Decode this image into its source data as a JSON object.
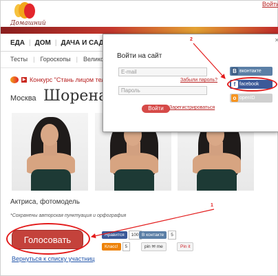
{
  "header": {
    "logo_text": "Домашний",
    "login_link": "Войти"
  },
  "nav": {
    "items": [
      "ЕДА",
      "ДОМ",
      "ДАЧА И САД"
    ]
  },
  "subnav": {
    "items": [
      "Тесты",
      "Гороскопы",
      "Великолеп"
    ]
  },
  "breadcrumb": {
    "link": "Конкурс \"Стань лицом теле"
  },
  "profile": {
    "city": "Москва",
    "name": "Шорена",
    "description": "Актриса, фотомодель",
    "note": "*Сохранены авторская пунктуация и орфография"
  },
  "actions": {
    "vote_label": "Голосовать",
    "back_link": "Вернуться к списку участниц"
  },
  "social": {
    "fb_label": "Нравится",
    "fb_count": "100",
    "vk_label": "В контакте",
    "vk_count": "5",
    "ok_label": "Класс!",
    "ok_count": "5",
    "pin_label": "pin ✉ me",
    "pinterest_label": "Pin it"
  },
  "modal": {
    "title": "Войти на сайт",
    "close": "✕",
    "email_placeholder": "E-mail",
    "password_placeholder": "Пароль",
    "forgot_link": "Забыли пароль?",
    "login_label": "Войти",
    "register_link": "Зарегистрироваться",
    "vk_button": "вконтакте",
    "fb_button": "facebook",
    "openid_button": "openID"
  },
  "annotations": {
    "marker1": "1",
    "marker2": "2"
  },
  "colors": {
    "brand_red": "#c4423b",
    "facebook": "#3b5998",
    "vk": "#5b7fa6",
    "annotation": "#e31b1b"
  }
}
